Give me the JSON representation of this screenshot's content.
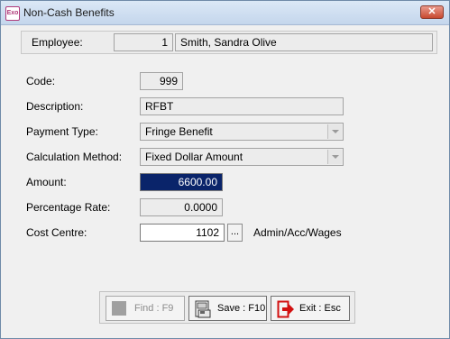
{
  "window": {
    "title": "Non-Cash Benefits",
    "icon_text": "Exo",
    "close_glyph": "✕"
  },
  "employee": {
    "label": "Employee:",
    "id": "1",
    "name": "Smith, Sandra Olive"
  },
  "fields": {
    "code": {
      "label": "Code:",
      "value": "999"
    },
    "description": {
      "label": "Description:",
      "value": "RFBT"
    },
    "payment_type": {
      "label": "Payment Type:",
      "value": "Fringe Benefit"
    },
    "calculation_method": {
      "label": "Calculation Method:",
      "value": "Fixed Dollar Amount"
    },
    "amount": {
      "label": "Amount:",
      "value": "6600.00"
    },
    "percentage_rate": {
      "label": "Percentage Rate:",
      "value": "0.0000"
    },
    "cost_centre": {
      "label": "Cost Centre:",
      "value": "1102",
      "browse_label": "...",
      "description": "Admin/Acc/Wages"
    }
  },
  "buttons": {
    "find": {
      "label": "Find : F9",
      "enabled": false
    },
    "save": {
      "label": "Save : F10"
    },
    "exit": {
      "label": "Exit : Esc"
    }
  },
  "colors": {
    "selection": "#0a246a",
    "exit_icon": "#d21010",
    "title_gradient_top": "#dbe8f6"
  }
}
